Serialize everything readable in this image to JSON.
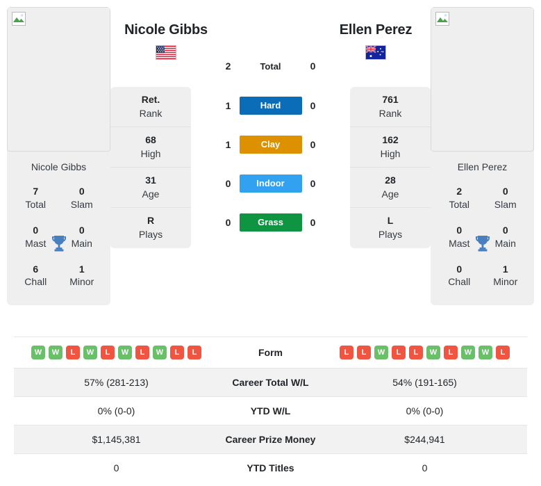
{
  "players": {
    "left": {
      "name": "Nicole Gibbs",
      "flag": "us-flag-icon",
      "photo_alt": "Nicole Gibbs",
      "card_name": "Nicole Gibbs",
      "titles": [
        {
          "value": "7",
          "label": "Total"
        },
        {
          "value": "0",
          "label": "Slam"
        },
        {
          "value": "0",
          "label": "Mast"
        },
        {
          "value": "0",
          "label": "Main"
        },
        {
          "value": "6",
          "label": "Chall"
        },
        {
          "value": "1",
          "label": "Minor"
        }
      ],
      "stats": [
        {
          "value": "Ret.",
          "label": "Rank"
        },
        {
          "value": "68",
          "label": "High"
        },
        {
          "value": "31",
          "label": "Age"
        },
        {
          "value": "R",
          "label": "Plays"
        }
      ],
      "form": [
        "W",
        "W",
        "L",
        "W",
        "L",
        "W",
        "L",
        "W",
        "L",
        "L"
      ]
    },
    "right": {
      "name": "Ellen Perez",
      "flag": "au-flag-icon",
      "photo_alt": "Ellen Perez",
      "card_name": "Ellen Perez",
      "titles": [
        {
          "value": "2",
          "label": "Total"
        },
        {
          "value": "0",
          "label": "Slam"
        },
        {
          "value": "0",
          "label": "Mast"
        },
        {
          "value": "0",
          "label": "Main"
        },
        {
          "value": "0",
          "label": "Chall"
        },
        {
          "value": "1",
          "label": "Minor"
        }
      ],
      "stats": [
        {
          "value": "761",
          "label": "Rank"
        },
        {
          "value": "162",
          "label": "High"
        },
        {
          "value": "28",
          "label": "Age"
        },
        {
          "value": "L",
          "label": "Plays"
        }
      ],
      "form": [
        "L",
        "L",
        "W",
        "L",
        "L",
        "W",
        "L",
        "W",
        "W",
        "L"
      ]
    }
  },
  "head_to_head": [
    {
      "label": "Total",
      "left": "2",
      "right": "0",
      "pill": false,
      "color": ""
    },
    {
      "label": "Hard",
      "left": "1",
      "right": "0",
      "pill": true,
      "color": "#0b6cb7"
    },
    {
      "label": "Clay",
      "left": "1",
      "right": "0",
      "pill": true,
      "color": "#dd9000"
    },
    {
      "label": "Indoor",
      "left": "0",
      "right": "0",
      "pill": true,
      "color": "#32a1f0"
    },
    {
      "label": "Grass",
      "left": "0",
      "right": "0",
      "pill": true,
      "color": "#0f9442"
    }
  ],
  "comparison_rows": [
    {
      "label": "Form",
      "left": "",
      "right": "",
      "type": "form"
    },
    {
      "label": "Career Total W/L",
      "left": "57% (281-213)",
      "right": "54% (191-165)",
      "type": "text"
    },
    {
      "label": "YTD W/L",
      "left": "0% (0-0)",
      "right": "0% (0-0)",
      "type": "text"
    },
    {
      "label": "Career Prize Money",
      "left": "$1,145,381",
      "right": "$244,941",
      "type": "text"
    },
    {
      "label": "YTD Titles",
      "left": "0",
      "right": "0",
      "type": "text"
    }
  ],
  "icons": {
    "trophy": "trophy-icon",
    "broken_image": "broken-image-icon"
  },
  "colors": {
    "hard": "#0b6cb7",
    "clay": "#dd9000",
    "indoor": "#32a1f0",
    "grass": "#0f9442",
    "win": "#6abf69",
    "loss": "#ef5540",
    "trophy": "#3d7ebf",
    "card_bg": "#efefef"
  }
}
